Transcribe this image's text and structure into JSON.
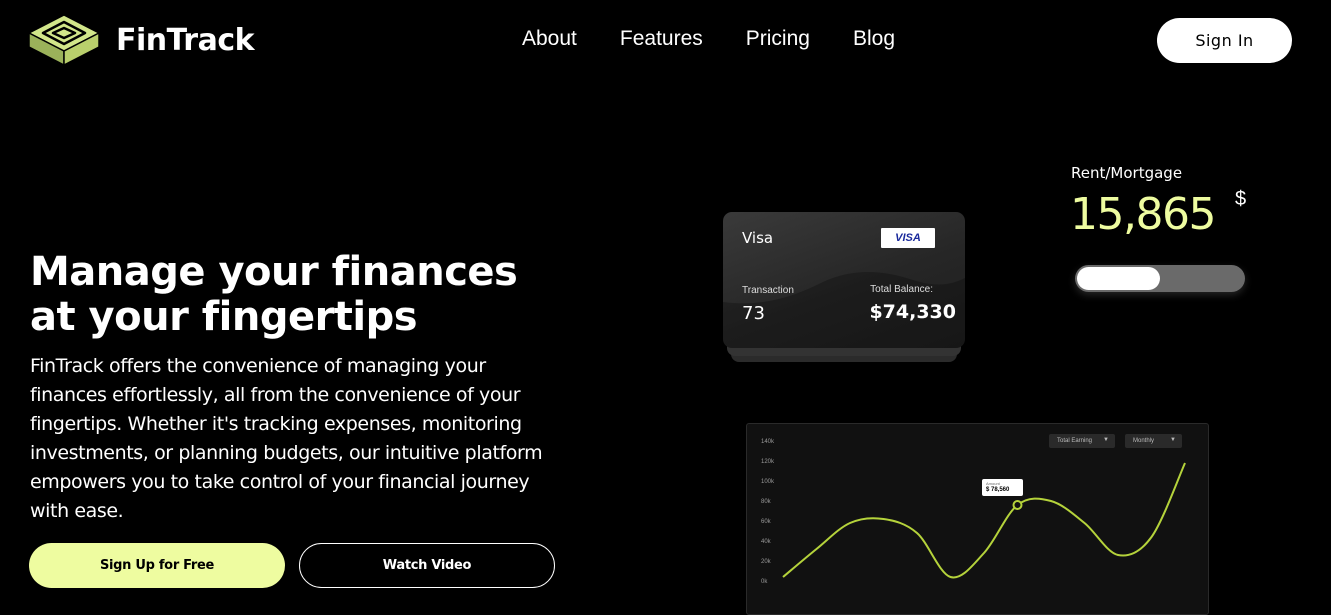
{
  "brand": {
    "name": "FinTrack",
    "logo_color": "#d2e68a"
  },
  "nav": {
    "items": [
      "About",
      "Features",
      "Pricing",
      "Blog"
    ],
    "sign_in": "Sign In"
  },
  "hero": {
    "title_line1": "Manage your finances",
    "title_line2": "at your fingertips",
    "body": "FinTrack offers the convenience of managing your finances effortlessly, all from the convenience of your fingertips. Whether it's tracking expenses, monitoring investments, or planning budgets, our intuitive platform empowers you to take control of your financial journey with ease.",
    "cta_primary": "Sign Up for Free",
    "cta_secondary": "Watch Video",
    "accent_color": "#eefca0"
  },
  "card": {
    "brand": "Visa",
    "badge": "VISA",
    "transaction_label": "Transaction",
    "transaction_value": "73",
    "balance_label": "Total Balance:",
    "balance_value": "$74,330"
  },
  "rent": {
    "label": "Rent/Mortgage",
    "value": "15,865",
    "currency": "$",
    "progress_fraction": 0.5
  },
  "chart": {
    "dropdown_metric": "Total Earning",
    "dropdown_period": "Monthly",
    "tooltip_label": "Amount",
    "tooltip_value": "$ 78,560"
  },
  "chart_data": {
    "type": "line",
    "yticks": [
      "140k",
      "120k",
      "100k",
      "80k",
      "60k",
      "40k",
      "20k",
      "0k"
    ],
    "ylim": [
      0,
      140000
    ],
    "series": [
      {
        "color": "#b5d33b",
        "points": [
          [
            0,
            4000
          ],
          [
            1,
            32000
          ],
          [
            2,
            58000
          ],
          [
            3,
            62000
          ],
          [
            4,
            48000
          ],
          [
            5,
            4000
          ],
          [
            6,
            28000
          ],
          [
            7,
            76000
          ],
          [
            8,
            80000
          ],
          [
            9,
            58000
          ],
          [
            10,
            26000
          ],
          [
            11,
            44000
          ],
          [
            12,
            118000
          ]
        ]
      }
    ],
    "highlight_index": 7,
    "grid": false
  }
}
